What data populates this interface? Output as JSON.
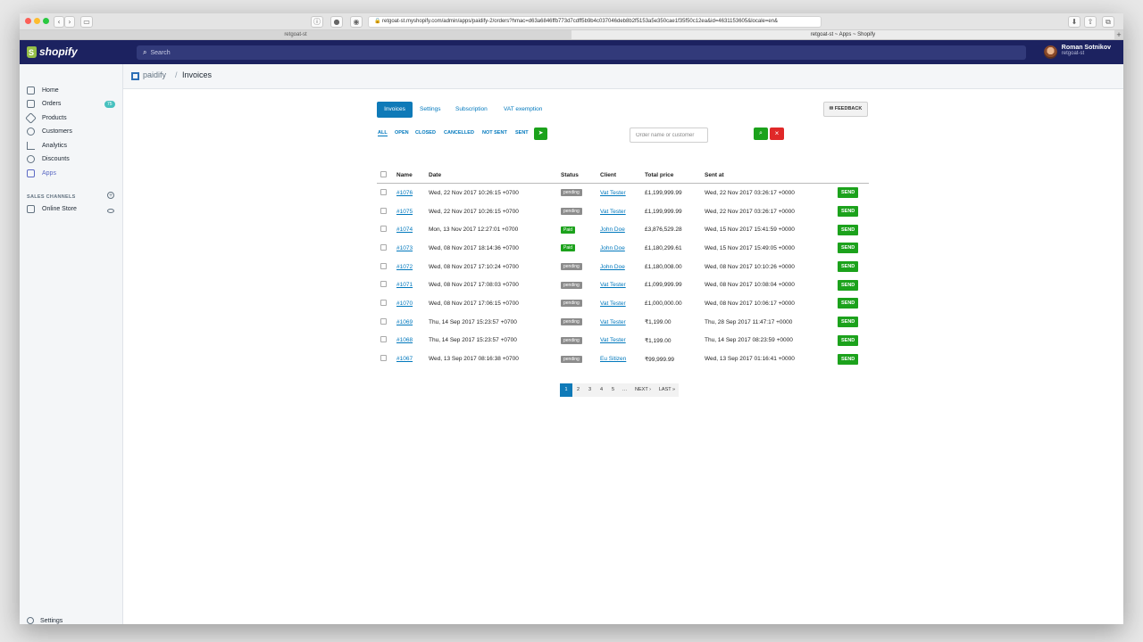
{
  "browser": {
    "url": "retgoat-st.myshopify.com/admin/apps/paidify-2/orders?hmac=d63a6846ffb773d7cdff5b9b4c037046deb8b2f5153a5e350cae1f35f50c12ea&id=4631153605&locale=en&",
    "tab_left": "retgoat-st",
    "tab_right": "retgoat-st ~ Apps ~ Shopify"
  },
  "topbar": {
    "logo": "shopify",
    "search_placeholder": "Search",
    "user_name": "Roman Sotnikov",
    "user_shop": "retgoat-st"
  },
  "sidebar": {
    "items": [
      {
        "label": "Home",
        "icon": "home-icon"
      },
      {
        "label": "Orders",
        "icon": "orders-icon",
        "badge": "75"
      },
      {
        "label": "Products",
        "icon": "tag-icon"
      },
      {
        "label": "Customers",
        "icon": "person-icon"
      },
      {
        "label": "Analytics",
        "icon": "chart-icon"
      },
      {
        "label": "Discounts",
        "icon": "discount-icon"
      },
      {
        "label": "Apps",
        "icon": "apps-icon",
        "active": true
      }
    ],
    "sales_channels_heading": "SALES CHANNELS",
    "online_store": "Online Store",
    "settings": "Settings"
  },
  "breadcrumb": {
    "app": "paidify",
    "separator": "/",
    "title": "Invoices"
  },
  "tabs": [
    "Invoices",
    "Settings",
    "Subscription",
    "VAT exemption"
  ],
  "feedback_label": "✉ FEEDBACK",
  "filters": [
    "ALL",
    "OPEN",
    "CLOSED",
    "CANCELLED",
    "NOT SENT",
    "SENT"
  ],
  "search_placeholder": "Order name or customer",
  "table": {
    "headers": [
      "Name",
      "Date",
      "Status",
      "Client",
      "Total price",
      "Sent at"
    ],
    "rows": [
      {
        "name": "#1076",
        "date": "Wed, 22 Nov 2017 10:26:15 +0700",
        "status": "pending",
        "client": "Vat Tester",
        "total": "£1,199,999.99",
        "sent_at": "Wed, 22 Nov 2017 03:26:17 +0000",
        "action": "SEND"
      },
      {
        "name": "#1075",
        "date": "Wed, 22 Nov 2017 10:26:15 +0700",
        "status": "pending",
        "client": "Vat Tester",
        "total": "£1,199,999.99",
        "sent_at": "Wed, 22 Nov 2017 03:26:17 +0000",
        "action": "SEND"
      },
      {
        "name": "#1074",
        "date": "Mon, 13 Nov 2017 12:27:01 +0700",
        "status": "Paid",
        "client": "John Doe",
        "total": "£3,876,529.28",
        "sent_at": "Wed, 15 Nov 2017 15:41:59 +0000",
        "action": "SEND"
      },
      {
        "name": "#1073",
        "date": "Wed, 08 Nov 2017 18:14:36 +0700",
        "status": "Paid",
        "client": "John Doe",
        "total": "£1,180,299.61",
        "sent_at": "Wed, 15 Nov 2017 15:49:05 +0000",
        "action": "SEND"
      },
      {
        "name": "#1072",
        "date": "Wed, 08 Nov 2017 17:10:24 +0700",
        "status": "pending",
        "client": "John Doe",
        "total": "£1,180,008.00",
        "sent_at": "Wed, 08 Nov 2017 10:10:26 +0000",
        "action": "SEND"
      },
      {
        "name": "#1071",
        "date": "Wed, 08 Nov 2017 17:08:03 +0700",
        "status": "pending",
        "client": "Vat Tester",
        "total": "£1,099,999.99",
        "sent_at": "Wed, 08 Nov 2017 10:08:04 +0000",
        "action": "SEND"
      },
      {
        "name": "#1070",
        "date": "Wed, 08 Nov 2017 17:06:15 +0700",
        "status": "pending",
        "client": "Vat Tester",
        "total": "£1,000,000.00",
        "sent_at": "Wed, 08 Nov 2017 10:06:17 +0000",
        "action": "SEND"
      },
      {
        "name": "#1069",
        "date": "Thu, 14 Sep 2017 15:23:57 +0700",
        "status": "pending",
        "client": "Vat Tester",
        "total": "₹1,199.00",
        "sent_at": "Thu, 28 Sep 2017 11:47:17 +0000",
        "action": "SEND"
      },
      {
        "name": "#1068",
        "date": "Thu, 14 Sep 2017 15:23:57 +0700",
        "status": "pending",
        "client": "Vat Tester",
        "total": "₹1,199.00",
        "sent_at": "Thu, 14 Sep 2017 08:23:59 +0000",
        "action": "SEND"
      },
      {
        "name": "#1067",
        "date": "Wed, 13 Sep 2017 08:16:38 +0700",
        "status": "pending",
        "client": "Eu Sitizen",
        "total": "₹99,999.99",
        "sent_at": "Wed, 13 Sep 2017 01:16:41 +0000",
        "action": "SEND"
      }
    ]
  },
  "pagination": [
    "1",
    "2",
    "3",
    "4",
    "5",
    "…",
    "NEXT ›",
    "LAST »"
  ],
  "colors": {
    "topbar": "#1c2260",
    "accent": "#0f7ab8",
    "green": "#1ca21c",
    "red": "#e02828",
    "badge": "#47c1bf"
  }
}
